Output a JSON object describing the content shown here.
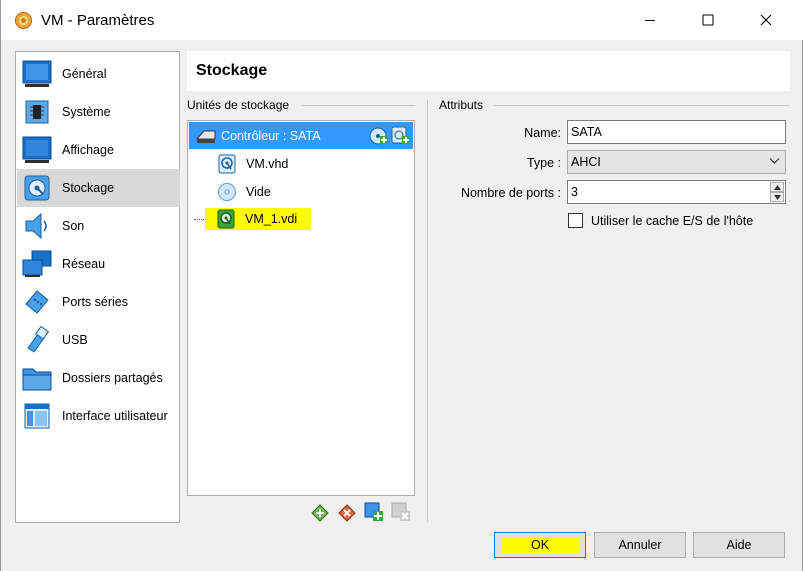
{
  "window": {
    "title": "VM - Paramètres"
  },
  "sidebar": {
    "items": [
      {
        "label": "Général",
        "icon": "general-icon"
      },
      {
        "label": "Système",
        "icon": "chip-icon"
      },
      {
        "label": "Affichage",
        "icon": "monitor-icon"
      },
      {
        "label": "Stockage",
        "icon": "storage-disk-icon",
        "selected": true
      },
      {
        "label": "Son",
        "icon": "speaker-icon"
      },
      {
        "label": "Réseau",
        "icon": "network-icon"
      },
      {
        "label": "Ports séries",
        "icon": "serial-port-icon"
      },
      {
        "label": "USB",
        "icon": "usb-icon"
      },
      {
        "label": "Dossiers partagés",
        "icon": "folder-icon"
      },
      {
        "label": "Interface utilisateur",
        "icon": "user-interface-icon"
      }
    ]
  },
  "header": {
    "title": "Stockage"
  },
  "storage": {
    "group_title": "Unités de stockage",
    "controller": "Contrôleur : SATA",
    "items": [
      {
        "label": "VM.vhd",
        "icon": "hard-disk-icon"
      },
      {
        "label": "Vide",
        "icon": "optical-disc-icon"
      },
      {
        "label": "VM_1.vdi",
        "icon": "hard-disk-icon",
        "highlighted": true
      }
    ]
  },
  "attributes": {
    "group_title": "Attributs",
    "name_label": "Name:",
    "name_value": "SATA",
    "type_label": "Type :",
    "type_value": "AHCI",
    "ports_label": "Nombre de ports :",
    "ports_value": "3",
    "cache_label": "Utiliser le cache E/S de l'hôte",
    "cache_checked": false
  },
  "buttons": {
    "ok": "OK",
    "cancel": "Annuler",
    "help": "Aide"
  },
  "colors": {
    "selection": "#3399ff",
    "highlight": "#fffb00",
    "sidebar_selected": "#d9d9d9"
  }
}
